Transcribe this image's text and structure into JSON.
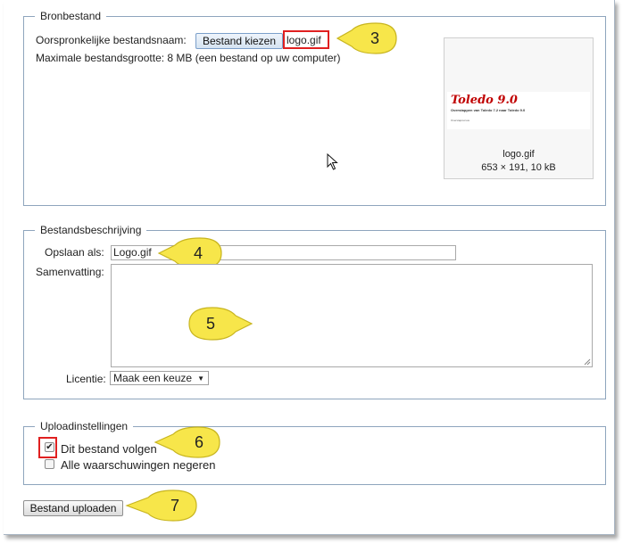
{
  "source_file": {
    "legend": "Bronbestand",
    "filename_label": "Oorspronkelijke bestandsnaam:",
    "choose_button": "Bestand kiezen",
    "chosen_file": "logo.gif",
    "max_size_text": "Maximale bestandsgrootte: 8 MB (een bestand op uw computer)",
    "preview": {
      "logo_title": "Toledo 9.0",
      "logo_subtitle": "Overstappen van Toledo 7.2 naar Toledo 9.0",
      "logo_small": "Overstapcursus",
      "name": "logo.gif",
      "info": "653 × 191, 10 kB"
    }
  },
  "description": {
    "legend": "Bestandsbeschrijving",
    "save_as_label": "Opslaan als:",
    "save_as_value": "Logo.gif",
    "summary_label": "Samenvatting:",
    "summary_value": "",
    "license_label": "Licentie:",
    "license_selected": "Maak een keuze"
  },
  "upload_settings": {
    "legend": "Uploadinstellingen",
    "watch_label": "Dit bestand volgen",
    "watch_checked": true,
    "ignore_warnings_label": "Alle waarschuwingen negeren",
    "ignore_warnings_checked": false
  },
  "upload_button": "Bestand uploaden",
  "callouts": [
    "3",
    "4",
    "5",
    "6",
    "7"
  ],
  "colors": {
    "callout_fill": "#f7e64a",
    "highlight": "#e02020",
    "border": "#8ea5bd"
  }
}
